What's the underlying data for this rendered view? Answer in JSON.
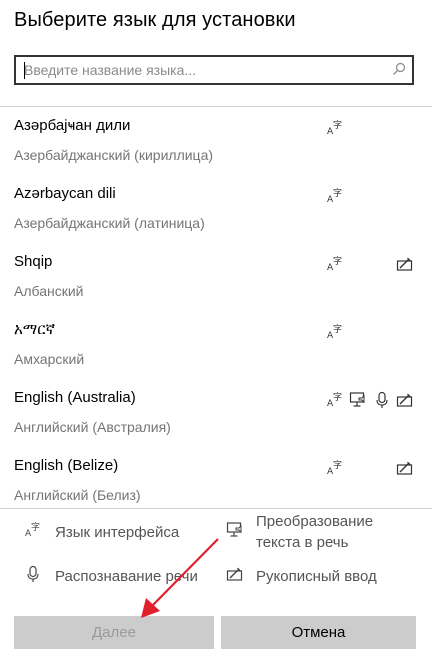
{
  "dialog": {
    "title": "Выберите язык для установки"
  },
  "search": {
    "placeholder": "Введите название языка...",
    "value": ""
  },
  "languages": [
    {
      "native": "Азәрбајҹан дили",
      "local": "Азербайджанский (кириллица)",
      "features": [
        "interface-language"
      ]
    },
    {
      "native": "Azərbaycan dili",
      "local": "Азербайджанский (латиница)",
      "features": [
        "interface-language"
      ]
    },
    {
      "native": "Shqip",
      "local": "Албанский",
      "features": [
        "interface-language",
        "handwriting"
      ]
    },
    {
      "native": "አማርኛ",
      "local": "Амхарский",
      "features": [
        "interface-language"
      ]
    },
    {
      "native": "English (Australia)",
      "local": "Английский (Австралия)",
      "features": [
        "interface-language",
        "text-to-speech",
        "speech-recognition",
        "handwriting"
      ]
    },
    {
      "native": "English (Belize)",
      "local": "Английский (Белиз)",
      "features": [
        "interface-language",
        "handwriting"
      ]
    }
  ],
  "legend": {
    "interface_language": "Язык интерфейса",
    "text_to_speech_line1": "Преобразование",
    "text_to_speech_line2": "текста в речь",
    "speech_recognition": "Распознавание речи",
    "handwriting": "Рукописный ввод"
  },
  "buttons": {
    "next": "Далее",
    "cancel": "Отмена"
  },
  "colors": {
    "annotation_arrow": "#e0202a",
    "button_bg": "#cccccc",
    "secondary_text": "#757575"
  }
}
